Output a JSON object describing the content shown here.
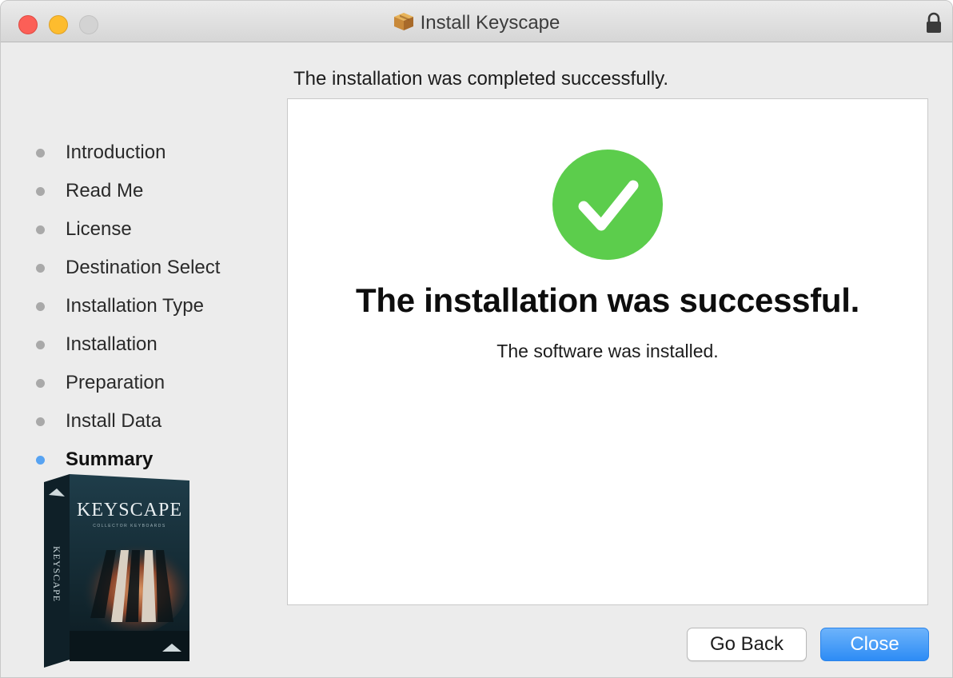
{
  "window": {
    "title": "Install Keyscape"
  },
  "headline": "The installation was completed successfully.",
  "sidebar": {
    "steps": [
      {
        "label": "Introduction",
        "active": false
      },
      {
        "label": "Read Me",
        "active": false
      },
      {
        "label": "License",
        "active": false
      },
      {
        "label": "Destination Select",
        "active": false
      },
      {
        "label": "Installation Type",
        "active": false
      },
      {
        "label": "Installation",
        "active": false
      },
      {
        "label": "Preparation",
        "active": false
      },
      {
        "label": "Install Data",
        "active": false
      },
      {
        "label": "Summary",
        "active": true
      }
    ]
  },
  "product_box": {
    "brand_text": "KEYSCAPE",
    "side_text": "KEYSCAPE",
    "tagline": "COLLECTOR KEYBOARDS"
  },
  "panel": {
    "status_icon": "checkmark-circle-icon",
    "title": "The installation was successful.",
    "subtitle": "The software was installed."
  },
  "buttons": {
    "back": "Go Back",
    "close": "Close"
  },
  "colors": {
    "success_green": "#5ccd4c",
    "active_dot": "#57a3f2",
    "close_button": "#3a93f6"
  }
}
